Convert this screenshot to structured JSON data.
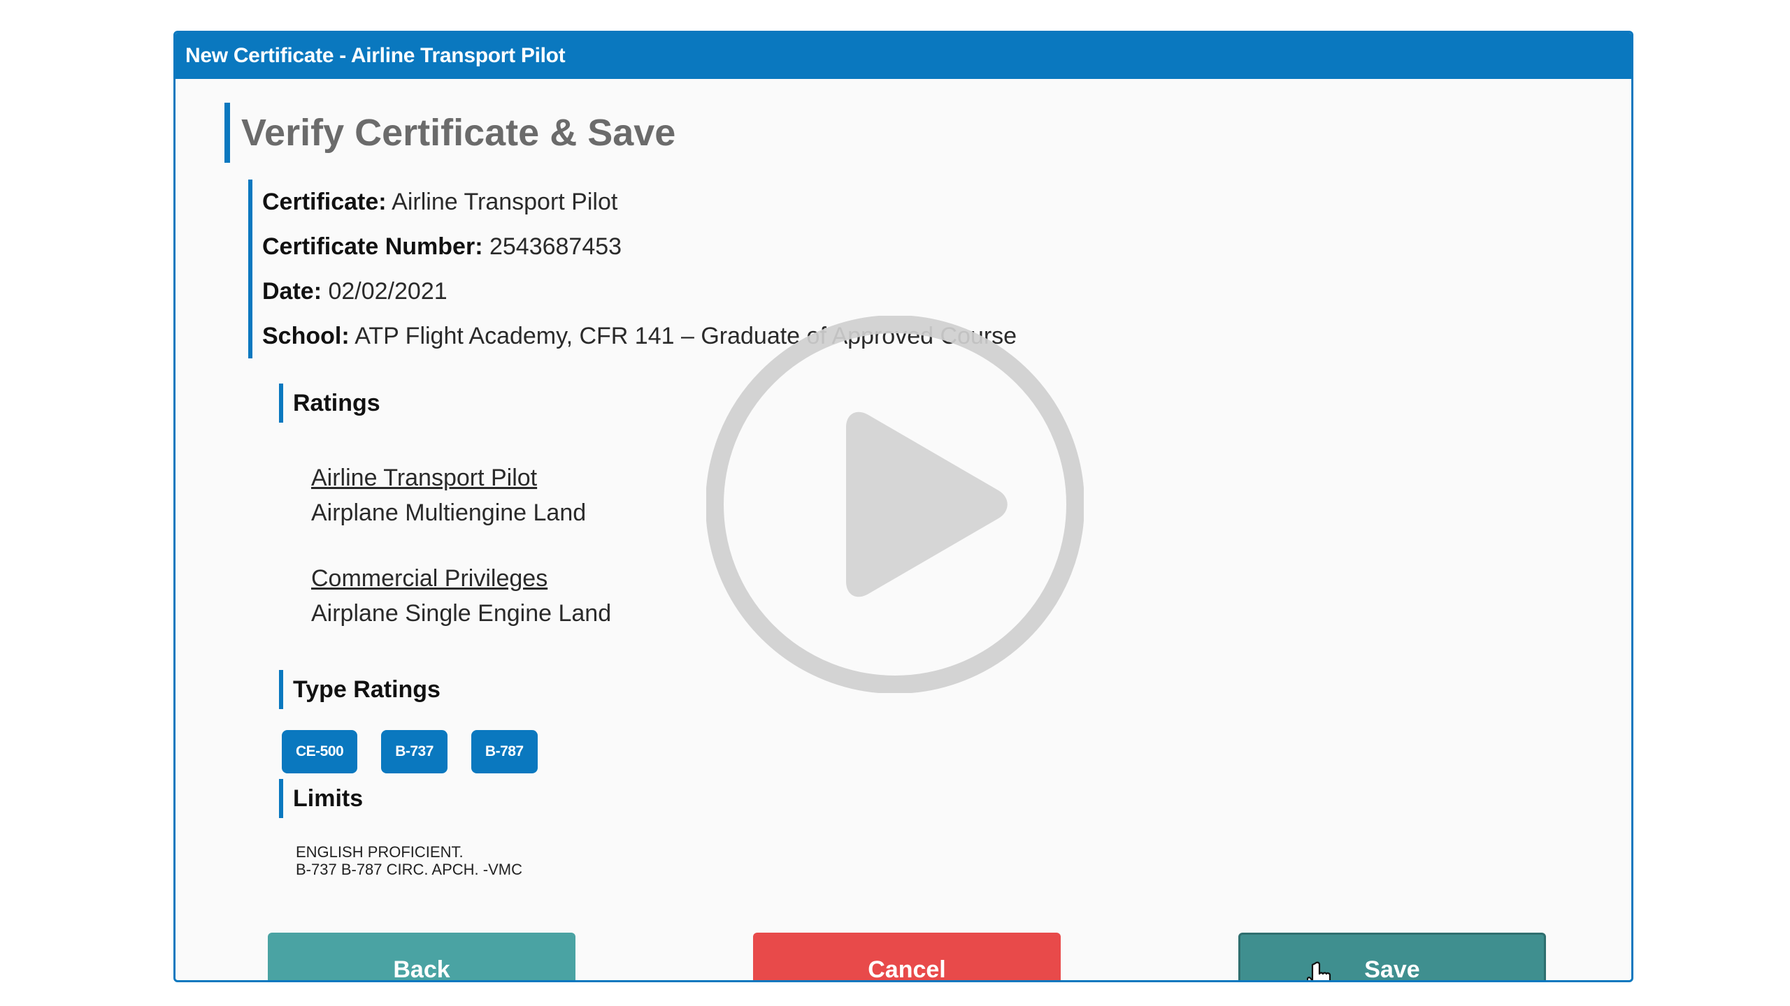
{
  "window": {
    "title": "New Certificate - Airline Transport Pilot"
  },
  "page": {
    "heading": "Verify Certificate & Save"
  },
  "details": [
    {
      "label": "Certificate:",
      "value": " Airline Transport Pilot"
    },
    {
      "label": "Certificate Number:",
      "value": " 2543687453"
    },
    {
      "label": "Date:",
      "value": " 02/02/2021"
    },
    {
      "label": "School:",
      "value": " ATP Flight Academy, CFR 141 – Graduate of Approved Course"
    }
  ],
  "ratings": {
    "heading": "Ratings",
    "items": [
      {
        "title": "Airline Transport Pilot",
        "sub": "Airplane Multiengine Land"
      },
      {
        "title": "Commercial Privileges",
        "sub": "Airplane Single Engine Land"
      }
    ]
  },
  "type_ratings": {
    "heading": "Type Ratings",
    "chips": [
      "CE-500",
      "B-737",
      "B-787"
    ]
  },
  "limits": {
    "heading": "Limits",
    "lines": [
      "ENGLISH PROFICIENT.",
      "B-737 B-787 CIRC. APCH. -VMC"
    ]
  },
  "buttons": {
    "back": "Back",
    "cancel": "Cancel",
    "save": "Save"
  },
  "colors": {
    "accent": "#0a78bf",
    "back": "#4aa3a3",
    "cancel": "#e84a4a",
    "save": "#3f8f8f"
  },
  "overlay": {
    "icon": "play-icon"
  }
}
